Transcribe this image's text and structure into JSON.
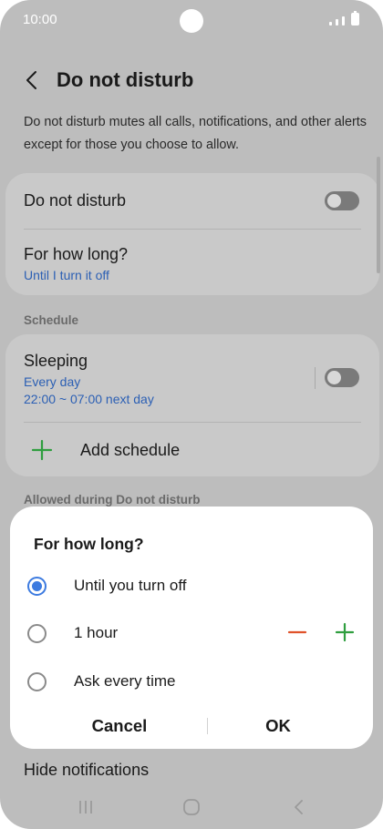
{
  "status_bar": {
    "time": "10:00"
  },
  "header": {
    "title": "Do not disturb"
  },
  "description": "Do not disturb mutes all calls, notifications, and other alerts except for those you choose to allow.",
  "dnd_card": {
    "toggle_label": "Do not disturb",
    "duration_title": "For how long?",
    "duration_value": "Until I turn it off"
  },
  "schedule": {
    "section_label": "Schedule",
    "item_title": "Sleeping",
    "item_days": "Every day",
    "item_time": "22:00 ~ 07:00 next day",
    "add_label": "Add schedule"
  },
  "allowed_section_label": "Allowed during Do not disturb",
  "hidden_row": "Hide notifications",
  "dialog": {
    "title": "For how long?",
    "options": [
      {
        "label": "Until you turn off",
        "selected": true
      },
      {
        "label": "1 hour",
        "selected": false
      },
      {
        "label": "Ask every time",
        "selected": false
      }
    ],
    "cancel_label": "Cancel",
    "ok_label": "OK"
  },
  "colors": {
    "accent_blue": "#3d7be0",
    "subtext_blue": "#2b5fb4",
    "minus_orange": "#e0522a",
    "plus_green": "#2f9e3f"
  }
}
